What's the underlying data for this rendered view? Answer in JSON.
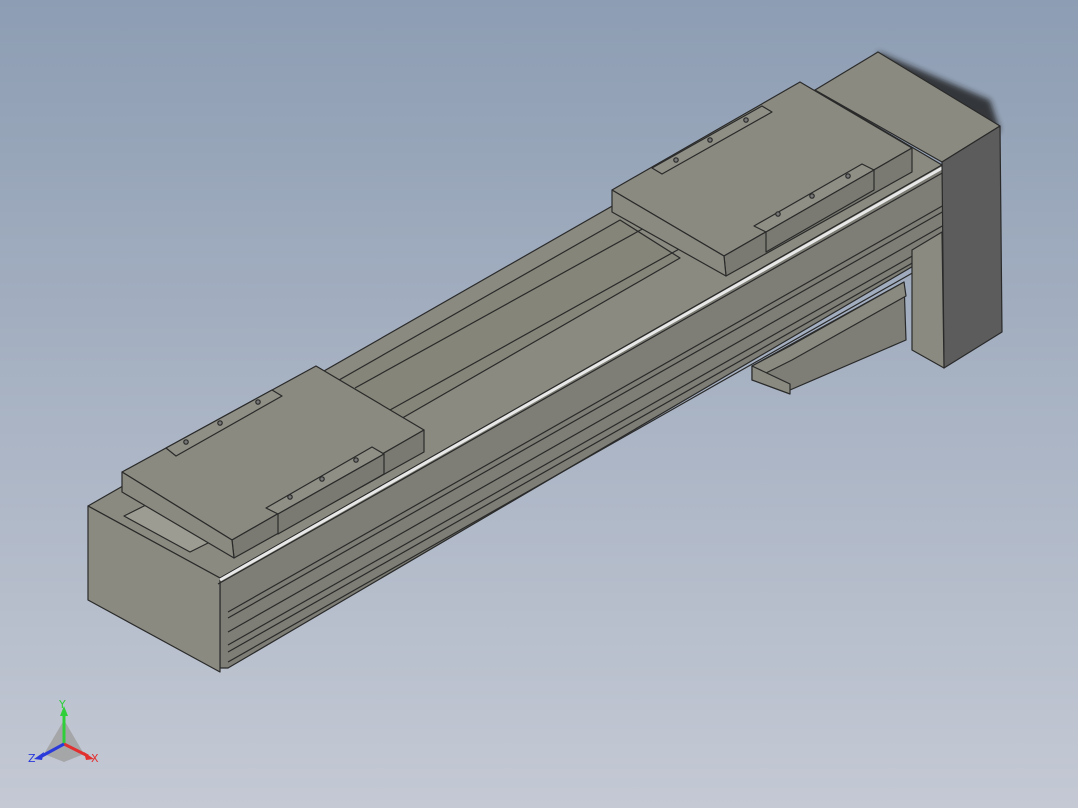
{
  "viewport": {
    "background_top": "#8d9db3",
    "background_bottom": "#c4c9d4",
    "model_color": "#8a8a80",
    "model_color_dark": "#6f6f68",
    "model_color_light": "#9c9c92",
    "motor_color": "#5c5c5c",
    "rail_highlight": "#e8e8e8"
  },
  "triad": {
    "x_label": "X",
    "y_label": "Y",
    "z_label": "Z",
    "x_color": "#e23030",
    "y_color": "#2fcf3a",
    "z_color": "#2a3adb"
  }
}
